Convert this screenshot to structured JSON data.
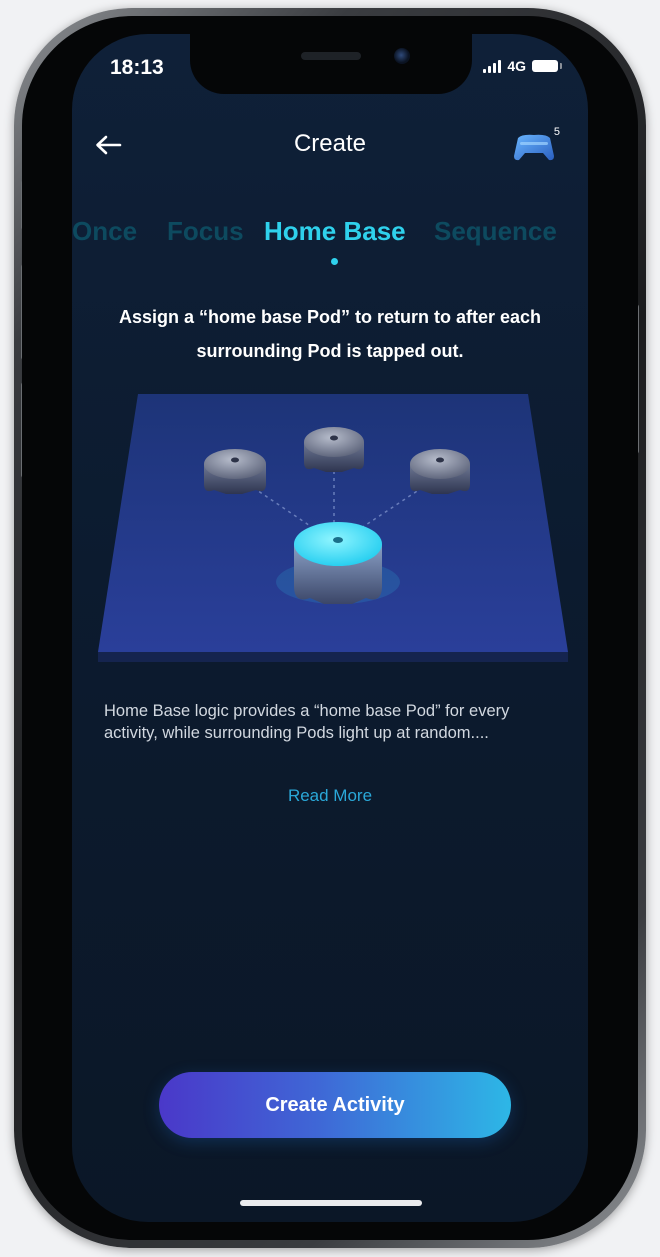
{
  "status_bar": {
    "time": "18:13",
    "network": "4G"
  },
  "header": {
    "title": "Create",
    "back_icon": "arrow-left-icon",
    "controller_icon": "gamepad-icon",
    "controller_count": "5"
  },
  "tabs": [
    {
      "label": "Once",
      "active": false
    },
    {
      "label": "Focus",
      "active": false
    },
    {
      "label": "Home Base",
      "active": true
    },
    {
      "label": "Sequence",
      "active": false
    }
  ],
  "main": {
    "heading": "Assign a “home base Pod” to return to after each surrounding Pod is tapped out.",
    "description": "Home Base logic provides a “home base Pod” for every activity, while surrounding Pods light up at random....",
    "read_more": "Read More"
  },
  "cta": {
    "label": "Create Activity"
  },
  "colors": {
    "background": "#0f2038",
    "accent": "#2fd1ec",
    "tab_inactive": "#0d4a5f",
    "link": "#2aa8d8",
    "cta_start": "#4a38c9",
    "cta_end": "#2db7e6"
  }
}
